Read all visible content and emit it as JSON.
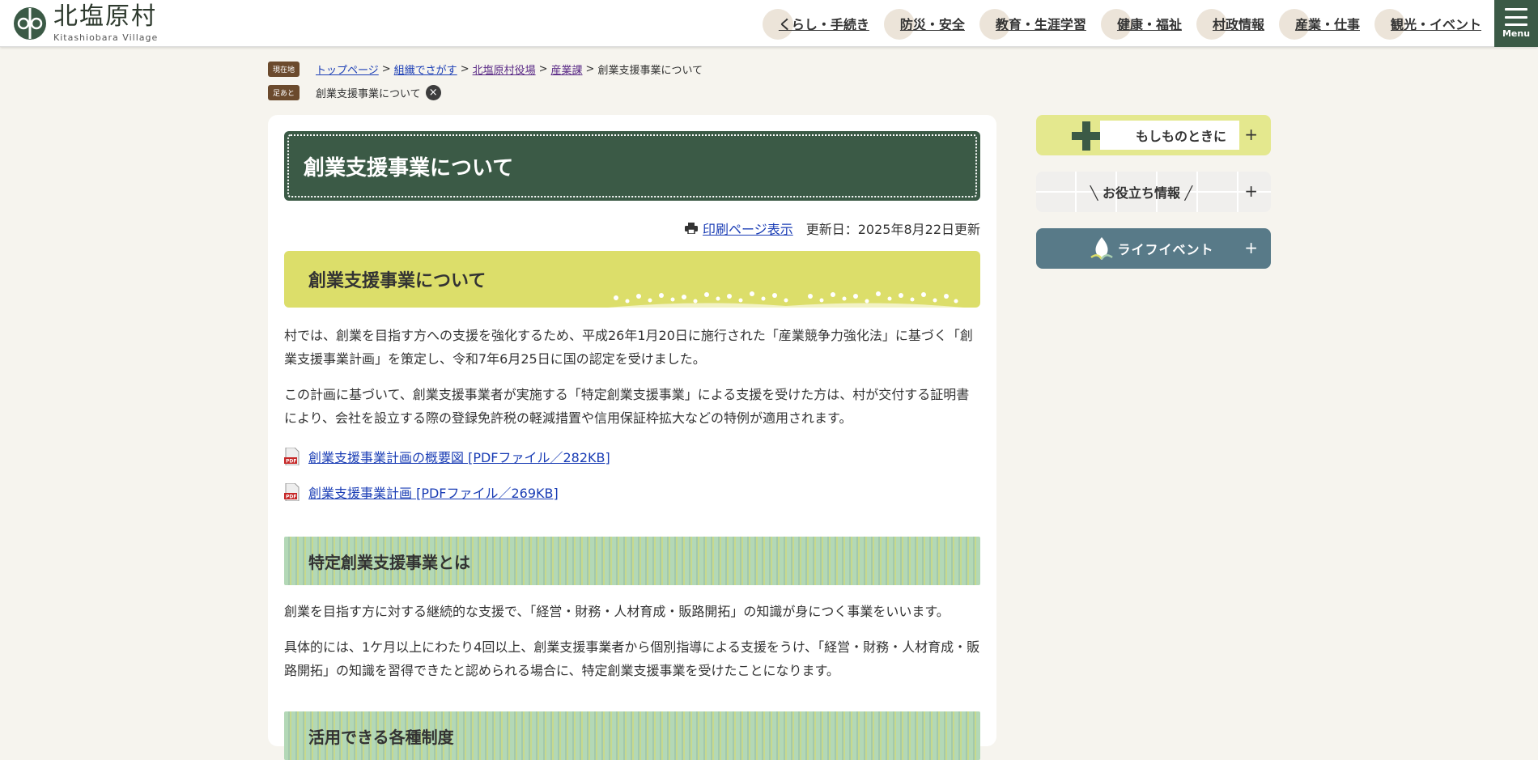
{
  "header": {
    "logo_jp": "北塩原村",
    "logo_en": "Kitashiobara Village",
    "nav": [
      "くらし・手続き",
      "防災・安全",
      "教育・生涯学習",
      "健康・福祉",
      "村政情報",
      "産業・仕事",
      "観光・イベント"
    ],
    "menu_label": "Menu"
  },
  "breadcrumb": {
    "current_badge": "現在地",
    "links": [
      "トップページ",
      "組織でさがす",
      "北塩原村役場",
      "産業課"
    ],
    "separator": ">",
    "current": "創業支援事業について",
    "history_badge": "足あと",
    "history_item": "創業支援事業について",
    "clear_icon": "×"
  },
  "main": {
    "title": "創業支援事業について",
    "print_label": "印刷ページ表示",
    "updated": "更新日：2025年8月22日更新",
    "section1_heading": "創業支援事業について",
    "para1": "村では、創業を目指す方への支援を強化するため、平成26年1月20日に施行された「産業競争力強化法」に基づく「創業支援事業計画」を策定し、令和7年6月25日に国の認定を受けました。",
    "para2": "この計画に基づいて、創業支援事業者が実施する「特定創業支援事業」による支援を受けた方は、村が交付する証明書により、会社を設立する際の登録免許税の軽減措置や信用保証枠拡大などの特例が適用されます。",
    "pdf_links": [
      "創業支援事業計画の概要図 [PDFファイル／282KB]",
      "創業支援事業計画 [PDFファイル／269KB]"
    ],
    "section2_heading": "特定創業支援事業とは",
    "para3": "創業を目指す方に対する継続的な支援で、「経営・財務・人材育成・販路開拓」の知識が身につく事業をいいます。",
    "para4": "具体的には、1ケ月以上にわたり4回以上、創業支援事業者から個別指導による支援をうけ、「経営・財務・人材育成・販路開拓」の知識を習得できたと認められる場合に、特定創業支援事業を受けたことになります。",
    "section3_heading": "活用できる各種制度"
  },
  "sidebar": {
    "emergency": "もしものときに",
    "useful": "╲ お役立ち情報 ╱",
    "life_event": "ライフイベント",
    "plus": "+"
  },
  "colors": {
    "accent_green": "#3b5a46",
    "heading_yellow": "#dcde6a",
    "heading_stripe": "#a9cfb0",
    "life_event_blue": "#587a88",
    "badge_brown": "#6b4a2d",
    "link_blue": "#1a3db5"
  }
}
